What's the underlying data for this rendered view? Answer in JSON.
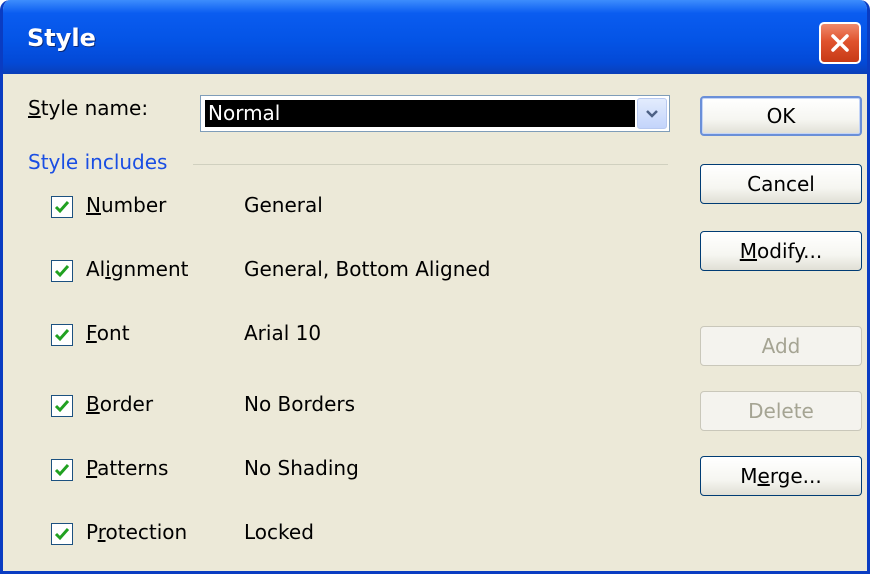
{
  "dialog": {
    "title": "Style",
    "style_name_label_prefix": "S",
    "style_name_label_rest": "tyle name:",
    "style_name_value": "Normal",
    "group_label": "Style includes"
  },
  "items": [
    {
      "prefix": "",
      "mnemonic": "N",
      "suffix": "umber",
      "value": "General",
      "checked": true
    },
    {
      "prefix": "Al",
      "mnemonic": "i",
      "suffix": "gnment",
      "value": "General, Bottom Aligned",
      "checked": true
    },
    {
      "prefix": "",
      "mnemonic": "F",
      "suffix": "ont",
      "value": "Arial 10",
      "checked": true
    },
    {
      "prefix": "",
      "mnemonic": "B",
      "suffix": "order",
      "value": "No Borders",
      "checked": true
    },
    {
      "prefix": "",
      "mnemonic": "P",
      "suffix": "atterns",
      "value": "No Shading",
      "checked": true
    },
    {
      "prefix": "P",
      "mnemonic": "r",
      "suffix": "otection",
      "value": "Locked",
      "checked": true
    }
  ],
  "buttons": {
    "ok": {
      "prefix": "",
      "mnemonic": "",
      "suffix": "OK",
      "enabled": true
    },
    "cancel": {
      "prefix": "",
      "mnemonic": "",
      "suffix": "Cancel",
      "enabled": true
    },
    "modify": {
      "prefix": "",
      "mnemonic": "M",
      "suffix": "odify...",
      "enabled": true
    },
    "add": {
      "prefix": "",
      "mnemonic": "",
      "suffix": "Add",
      "enabled": false
    },
    "delete": {
      "prefix": "",
      "mnemonic": "",
      "suffix": "Delete",
      "enabled": false
    },
    "merge": {
      "prefix": "M",
      "mnemonic": "e",
      "suffix": "rge...",
      "enabled": true
    }
  },
  "icons": {
    "close": "close-icon",
    "dropdown": "chevron-down-icon",
    "check": "checkmark-icon"
  },
  "colors": {
    "title_bar": "#0454e6",
    "close_button": "#e0532e",
    "group_label": "#1a4ee3",
    "checkmark": "#21a121",
    "selection": "#000000"
  }
}
